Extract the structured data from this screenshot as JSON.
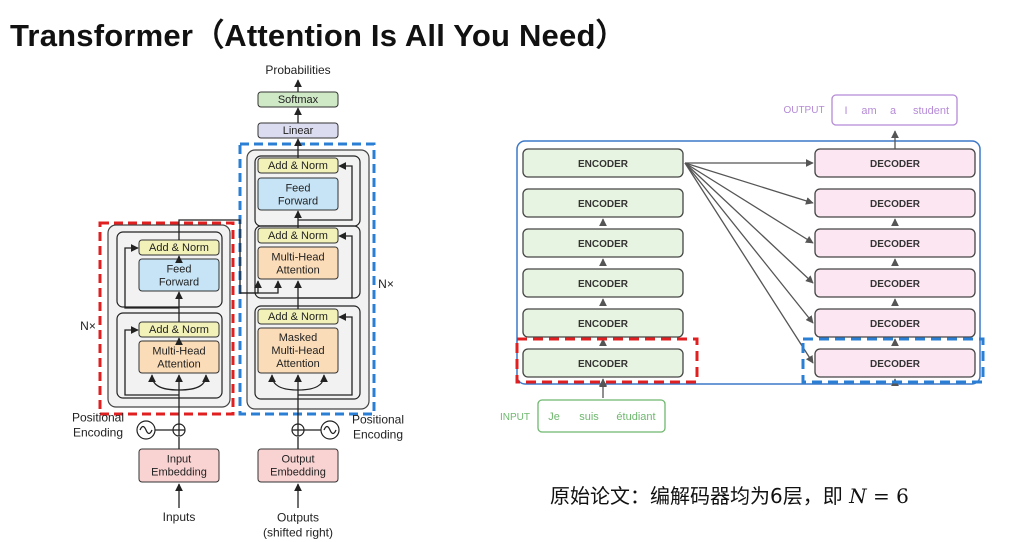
{
  "page": {
    "title": "Transformer（Attention Is All You Need）",
    "caption_text": "原始论文：编解码器均为6层，即 ",
    "caption_math_var": "N",
    "caption_math_rest": " = 6"
  },
  "left_diagram": {
    "probabilities": "Probabilities",
    "softmax": "Softmax",
    "linear": "Linear",
    "add_norm": "Add & Norm",
    "feed_forward": [
      "Feed",
      "Forward"
    ],
    "multi_head_attention": [
      "Multi-Head",
      "Attention"
    ],
    "masked_multi_head_attention": [
      "Masked",
      "Multi-Head",
      "Attention"
    ],
    "input_embedding": [
      "Input",
      "Embedding"
    ],
    "output_embedding": [
      "Output",
      "Embedding"
    ],
    "positional_encoding": [
      "Positional",
      "Encoding"
    ],
    "nx": "N×",
    "inputs": "Inputs",
    "outputs": [
      "Outputs",
      "(shifted right)"
    ],
    "colors": {
      "encoder_highlight": "#e02020",
      "decoder_highlight": "#2a7fd4",
      "softmax_fill": "#cfe8c6",
      "linear_fill": "#dcdcf0",
      "add_norm_fill": "#f2f2b8",
      "feed_forward_fill": "#c6e4f6",
      "attention_fill": "#fbdcb8",
      "embedding_fill": "#f9d2d2"
    }
  },
  "right_diagram": {
    "output_label": "OUTPUT",
    "output_tokens": [
      "I",
      "am",
      "a",
      "student"
    ],
    "input_label": "INPUT",
    "input_tokens": [
      "Je",
      "suis",
      "étudiant"
    ],
    "encoder_label": "ENCODER",
    "decoder_label": "DECODER",
    "layers": 6,
    "colors": {
      "encoder_fill": "#e8f4e2",
      "decoder_fill": "#fbe6f1",
      "frame": "#3c78c8",
      "output_text": "#b58ad6",
      "input_text": "#6fb86f"
    }
  }
}
